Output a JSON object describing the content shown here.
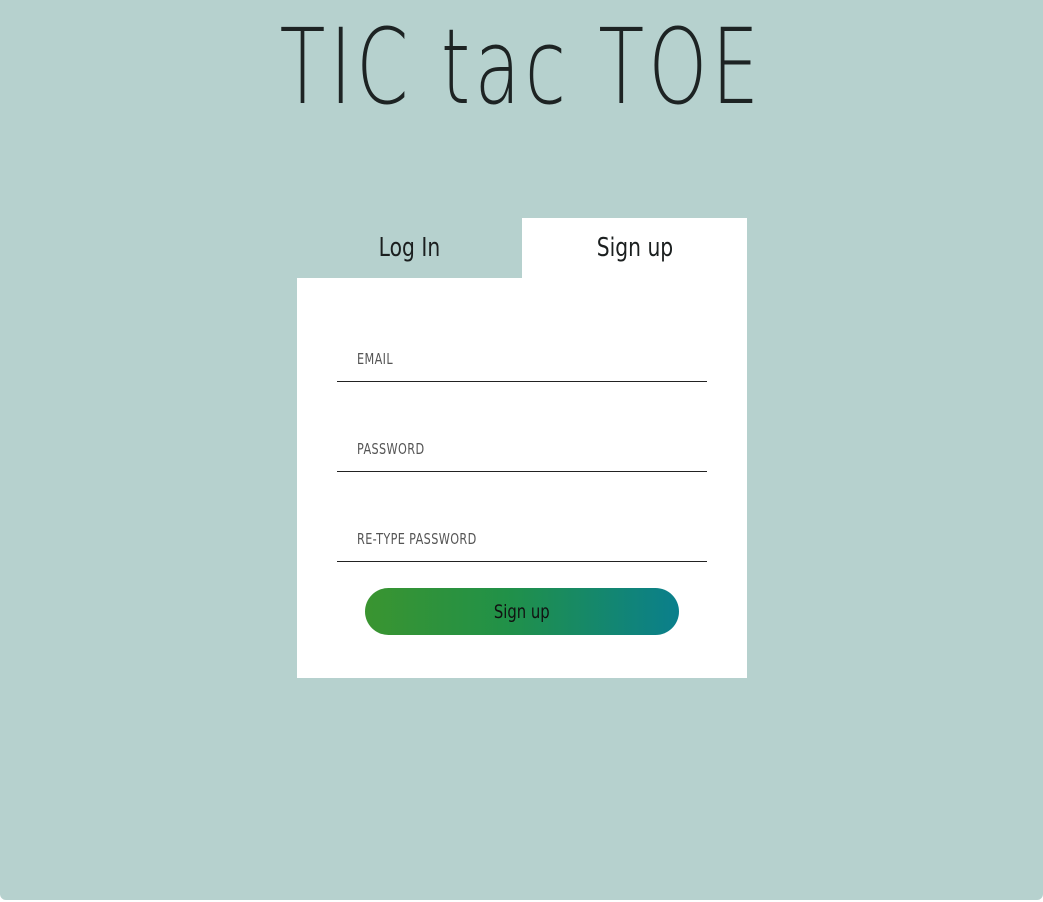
{
  "app": {
    "title": "TIC tac TOE"
  },
  "tabs": [
    {
      "label": "Log In",
      "active": false
    },
    {
      "label": "Sign up",
      "active": true
    }
  ],
  "form": {
    "email_placeholder": "EMAIL",
    "password_placeholder": "PASSWORD",
    "retype_password_placeholder": "RE-TYPE PASSWORD",
    "submit_label": "Sign up"
  },
  "colors": {
    "background": "#b6d1ce",
    "card": "#ffffff",
    "button_gradient_start": "#3a9430",
    "button_gradient_end": "#0a7f8c"
  }
}
